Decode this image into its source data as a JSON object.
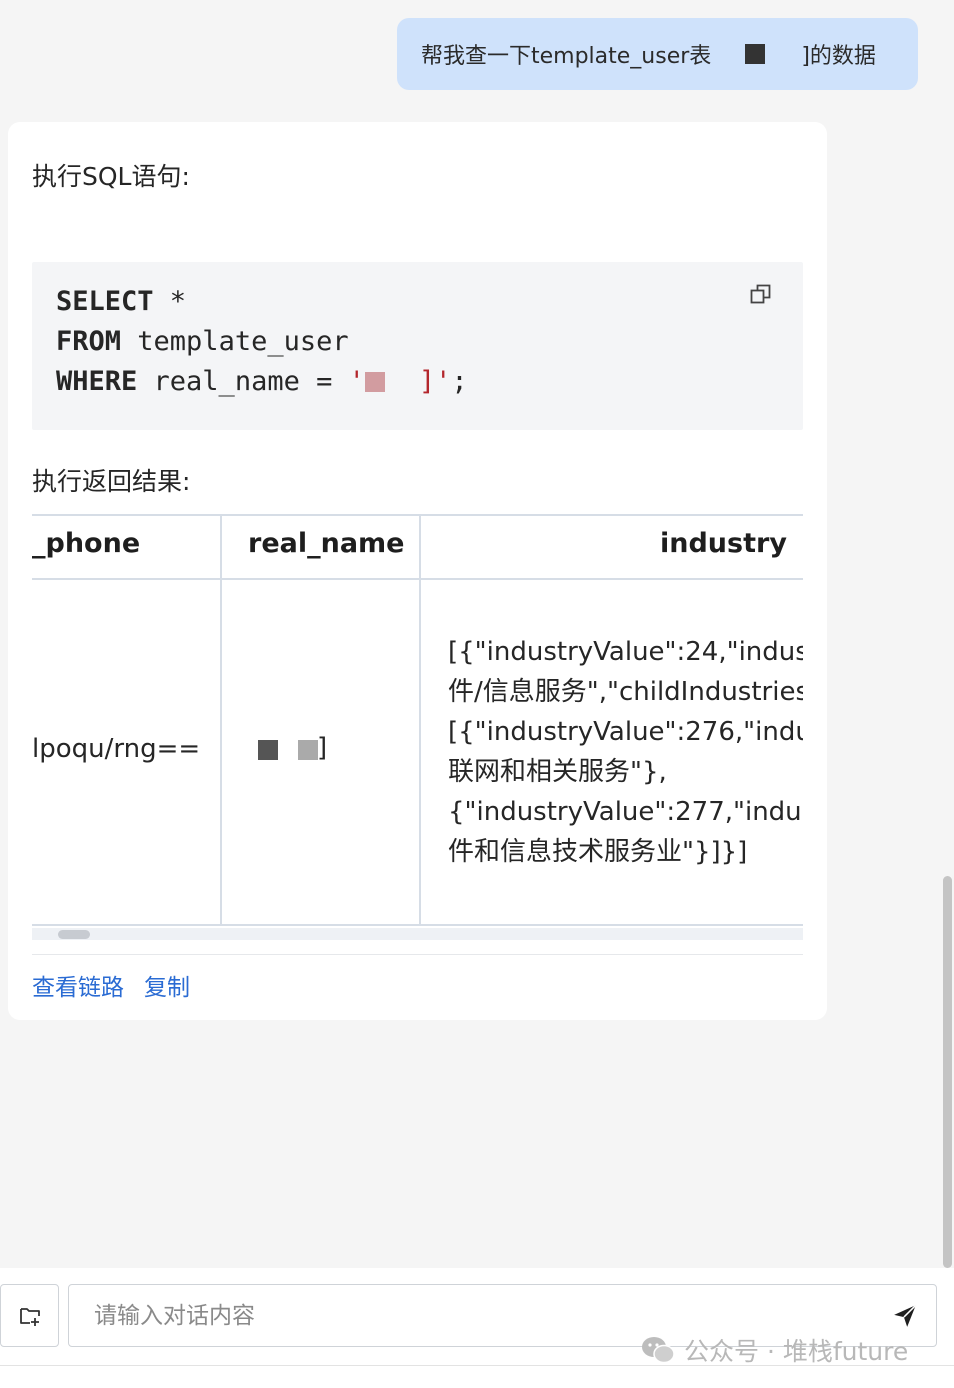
{
  "user_message": {
    "text_before": "帮我查一下template_user表",
    "text_after": "]的数据"
  },
  "answer": {
    "sql_label": "执行SQL语句:",
    "sql": {
      "kw1": "SELECT",
      "rest1": " *",
      "kw2": "FROM",
      "rest2": " template_user",
      "kw3": "WHERE",
      "rest3": " real_name = ",
      "str_open": "'",
      "str_close": "'",
      "str_tail": "]",
      "semi": ";"
    },
    "result_label": "执行返回结果:",
    "table": {
      "columns": [
        "_phone",
        "real_name",
        "industry"
      ],
      "rows": [
        {
          "phone": "lpoqu/rng==",
          "real_name_tail": "]",
          "industry": "[{\"industryValue\":24,\"indust\n件/信息服务\",\"childIndustries\n[{\"industryValue\":276,\"indu\n联网和相关服务\"},\n{\"industryValue\":277,\"indust\n件和信息技术服务业\"}]}]"
        }
      ]
    },
    "actions": {
      "view_trace": "查看链路",
      "copy": "复制"
    }
  },
  "input": {
    "placeholder": "请输入对话内容"
  },
  "watermark": "公众号 · 堆栈future",
  "icons": {
    "copy_code": "copy-icon",
    "attach": "folder-add-icon",
    "send": "send-icon",
    "watermark": "wechat-icon"
  }
}
